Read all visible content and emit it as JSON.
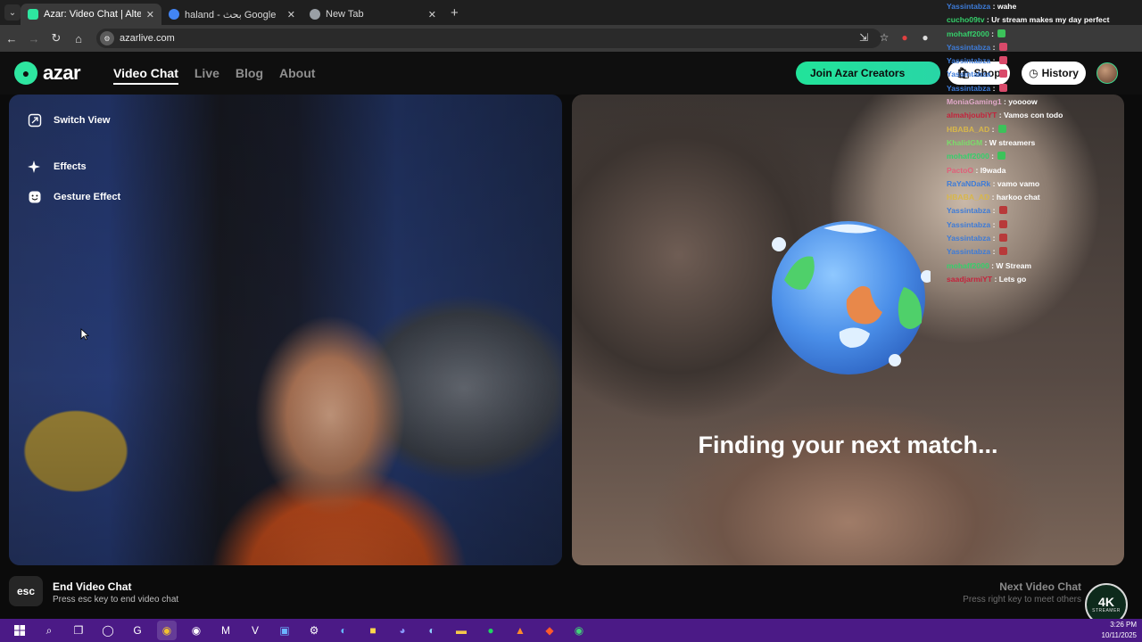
{
  "browser": {
    "tabs": [
      {
        "title": "Azar: Video Chat | Alternati",
        "active": true,
        "favicon_color": "#2ee6a0"
      },
      {
        "title": "haland - بحث Google",
        "active": false,
        "favicon_color": "#4285f4"
      },
      {
        "title": "New Tab",
        "active": false,
        "favicon_color": "#9aa0a6"
      }
    ],
    "new_tab_label": "+",
    "url": "azarlive.com"
  },
  "app": {
    "logo_text": "azar",
    "nav": [
      {
        "label": "Video Chat",
        "active": true
      },
      {
        "label": "Live",
        "active": false
      },
      {
        "label": "Blog",
        "active": false
      },
      {
        "label": "About",
        "active": false
      }
    ],
    "join_label": "Join Azar Creators",
    "shop_label": "Shop",
    "history_label": "History",
    "accent_color": "#2ee6a0"
  },
  "left_controls": [
    {
      "label": "Switch View",
      "icon": "switch-view-icon"
    },
    {
      "label": "Effects",
      "icon": "sparkle-icon"
    },
    {
      "label": "Gesture Effect",
      "icon": "smile-icon"
    }
  ],
  "right_pane": {
    "status_text": "Finding your next match..."
  },
  "chat": [
    {
      "user": "Yassintabza",
      "user_color": "#3d7bd8",
      "msg": "wahe"
    },
    {
      "user": "cucho09tv",
      "user_color": "#35d06b",
      "msg": "Ur stream makes my day perfect"
    },
    {
      "user": "mohaff2000",
      "user_color": "#35d06b",
      "msg": "",
      "emote": "#3cc25a"
    },
    {
      "user": "Yassintabza",
      "user_color": "#3d7bd8",
      "msg": "",
      "emote": "#d94a6a"
    },
    {
      "user": "Yassintabza",
      "user_color": "#3d7bd8",
      "msg": "",
      "emote": "#d94a6a"
    },
    {
      "user": "Yassintabza",
      "user_color": "#3d7bd8",
      "msg": "",
      "emote": "#d94a6a"
    },
    {
      "user": "Yassintabza",
      "user_color": "#3d7bd8",
      "msg": "",
      "emote": "#d94a6a"
    },
    {
      "user": "MoniaGaming1",
      "user_color": "#e0a8c8",
      "msg": "yoooow"
    },
    {
      "user": "almahjoubiYT",
      "user_color": "#c4233c",
      "msg": "Vamos con todo"
    },
    {
      "user": "HBABA_AD",
      "user_color": "#d8b74a",
      "msg": "",
      "emote": "#3cc25a"
    },
    {
      "user": "KhalidGM",
      "user_color": "#7bdc6a",
      "msg": "W streamers"
    },
    {
      "user": "mohaff2000",
      "user_color": "#35d06b",
      "msg": "",
      "emote": "#3cc25a"
    },
    {
      "user": "PactoO",
      "user_color": "#e0607a",
      "msg": "l9wada"
    },
    {
      "user": "RaYaNDaRk",
      "user_color": "#3d7bd8",
      "msg": "vamo vamo"
    },
    {
      "user": "HBABA_AD",
      "user_color": "#d8b74a",
      "msg": "harkoo chat"
    },
    {
      "user": "Yassintabza",
      "user_color": "#3d7bd8",
      "msg": "",
      "emote": "#b83a3a"
    },
    {
      "user": "Yassintabza",
      "user_color": "#3d7bd8",
      "msg": "",
      "emote": "#b83a3a"
    },
    {
      "user": "Yassintabza",
      "user_color": "#3d7bd8",
      "msg": "",
      "emote": "#b83a3a"
    },
    {
      "user": "Yassintabza",
      "user_color": "#3d7bd8",
      "msg": "",
      "emote": "#b83a3a"
    },
    {
      "user": "mohaff2000",
      "user_color": "#35d06b",
      "msg": "W Stream"
    },
    {
      "user": "saadjarmiYT",
      "user_color": "#c4233c",
      "msg": "Lets go"
    }
  ],
  "bottom": {
    "esc_key": "esc",
    "end_title": "End Video Chat",
    "end_sub": "Press esc key to end video chat",
    "next_title": "Next Video Chat",
    "next_sub": "Press right key to meet others"
  },
  "overlay_badge": {
    "text": "4K",
    "sub": "STREAMER"
  },
  "taskbar": {
    "time": "3:26 PM",
    "date": "10/11/2025"
  }
}
